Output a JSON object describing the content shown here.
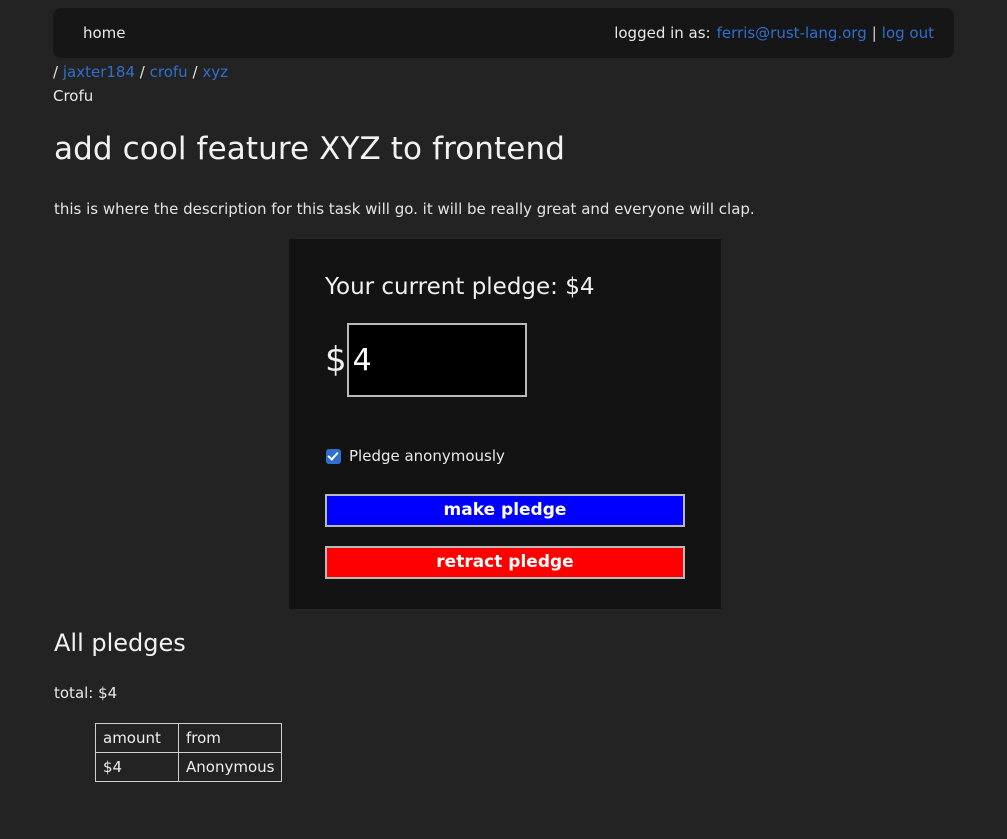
{
  "navbar": {
    "home_label": "home",
    "logged_in_label": "logged in as:",
    "user_email": "ferris@rust-lang.org",
    "separator": "|",
    "logout_label": "log out"
  },
  "breadcrumb": {
    "slash": "/",
    "items": [
      {
        "label": "jaxter184"
      },
      {
        "label": "crofu"
      },
      {
        "label": "xyz"
      }
    ],
    "org_name": "Crofu"
  },
  "task": {
    "title": "add cool feature XYZ to frontend",
    "description": "this is where the description for this task will go. it will be really great and everyone will clap."
  },
  "pledge_panel": {
    "current_pledge_label": "Your current pledge: $4",
    "dollar_symbol": "$",
    "amount_value": "4",
    "amount_placeholder": "",
    "anonymous_label": "Pledge anonymously",
    "anonymous_checked": true,
    "make_pledge_label": "make pledge",
    "retract_pledge_label": "retract pledge",
    "make_pledge_color": "#0000ff",
    "retract_pledge_color": "#ff0000"
  },
  "all_pledges": {
    "heading": "All pledges",
    "total_label": "total: $4",
    "columns": [
      "amount",
      "from"
    ],
    "rows": [
      {
        "amount": "$4",
        "from": "Anonymous"
      }
    ]
  },
  "colors": {
    "page_background": "#232323",
    "navbar_background": "#161616",
    "panel_background": "#131313",
    "link": "#2f6fd0",
    "accent_checkbox": "#2f6fd0"
  }
}
